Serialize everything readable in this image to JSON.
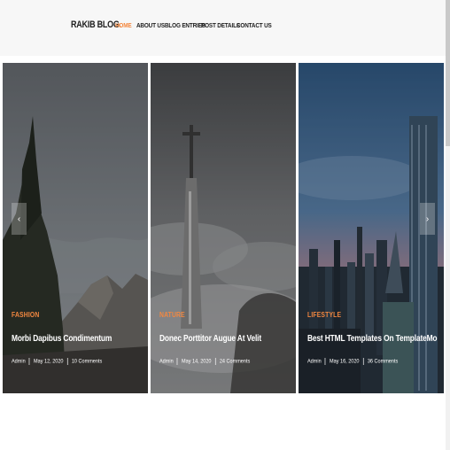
{
  "header": {
    "logo_text": "RAKIB BLOG",
    "logo_dot": ".",
    "nav": [
      {
        "label": "HOME",
        "active": true
      },
      {
        "label": "ABOUT US",
        "active": false
      },
      {
        "label": "BLOG ENTRIES",
        "active": false
      },
      {
        "label": "POST DETAILS",
        "active": false
      },
      {
        "label": "CONTACT US",
        "active": false
      }
    ]
  },
  "slider": {
    "prev_icon": "‹",
    "next_icon": "›",
    "cards": [
      {
        "category": "FASHION",
        "title": "Morbi Dapibus Condimentum",
        "author": "Admin",
        "date": "May 12, 2020",
        "comments": "10 Comments",
        "image": "mountain-forest-scene"
      },
      {
        "category": "NATURE",
        "title": "Donec Porttitor Augue At Velit",
        "author": "Admin",
        "date": "May 14, 2020",
        "comments": "24 Comments",
        "image": "tower-in-clouds-scene"
      },
      {
        "category": "LIFESTYLE",
        "title": "Best HTML Templates On TemplateMo",
        "author": "Admin",
        "date": "May 16, 2020",
        "comments": "36 Comments",
        "image": "city-skyline-scene"
      }
    ]
  },
  "colors": {
    "accent": "#f48840",
    "header_bg": "#f7f7f7",
    "text_dark": "#1e1e1e"
  }
}
